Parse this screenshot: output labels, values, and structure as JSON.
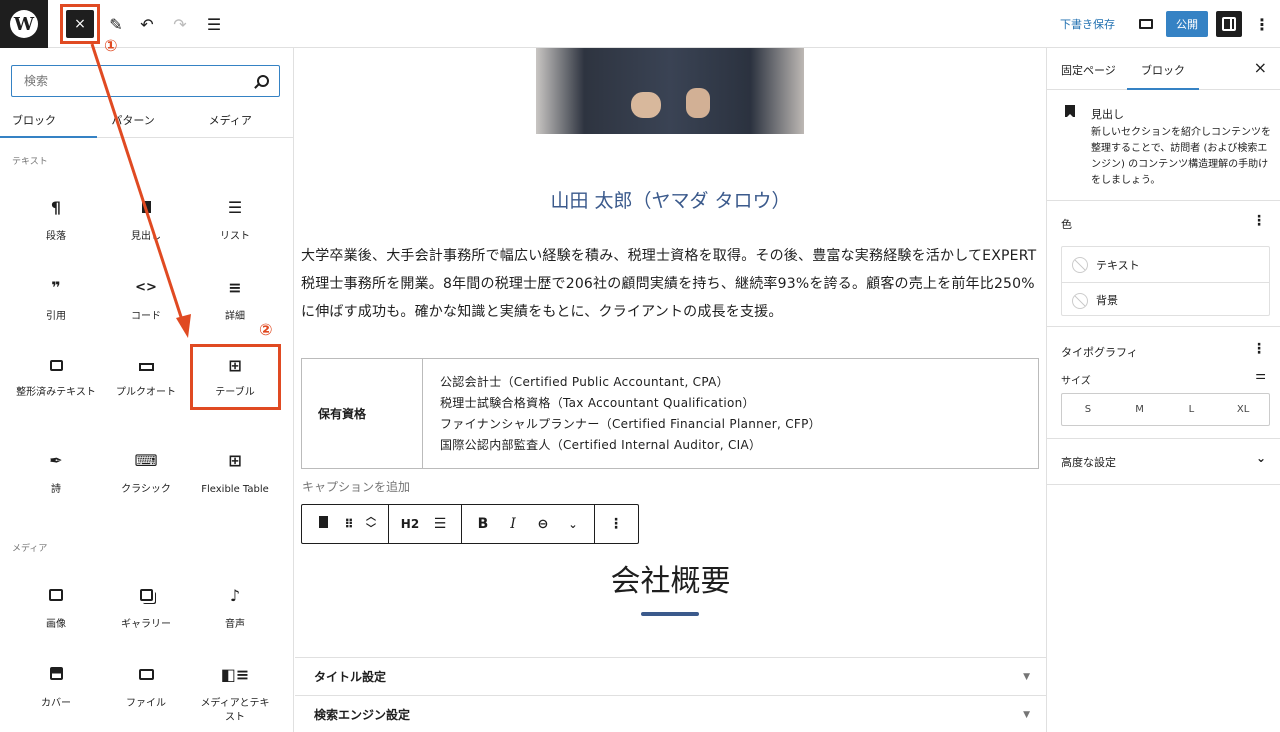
{
  "topbar": {
    "close_icon": "×",
    "draft_label": "下書き保存",
    "publish_label": "公開"
  },
  "inserter": {
    "search_placeholder": "検索",
    "tabs": [
      "ブロック",
      "パターン",
      "メディア"
    ],
    "active_tab": "ブロック",
    "text_category": "テキスト",
    "text_blocks": [
      {
        "label": "段落",
        "icon": "¶"
      },
      {
        "label": "見出し",
        "icon": "bookmark"
      },
      {
        "label": "リスト",
        "icon": "list"
      },
      {
        "label": "引用",
        "icon": "99"
      },
      {
        "label": "コード",
        "icon": "<>"
      },
      {
        "label": "詳細",
        "icon": "details"
      },
      {
        "label": "整形済みテキスト",
        "icon": "preformatted"
      },
      {
        "label": "プルクオート",
        "icon": "pullquote"
      },
      {
        "label": "テーブル",
        "icon": "table"
      },
      {
        "label": "詩",
        "icon": "feather"
      },
      {
        "label": "クラシック",
        "icon": "keyboard"
      },
      {
        "label": "Flexible Table",
        "icon": "flexible-table"
      }
    ],
    "media_category": "メディア",
    "media_blocks": [
      {
        "label": "画像",
        "icon": "image"
      },
      {
        "label": "ギャラリー",
        "icon": "gallery"
      },
      {
        "label": "音声",
        "icon": "♪"
      },
      {
        "label": "カバー",
        "icon": "cover"
      },
      {
        "label": "ファイル",
        "icon": "folder"
      },
      {
        "label": "メディアとテキスト",
        "icon": "media-text"
      }
    ]
  },
  "canvas": {
    "name_heading": "山田 太郎（ヤマダ タロウ）",
    "bio": "大学卒業後、大手会計事務所で幅広い経験を積み、税理士資格を取得。その後、豊富な実務経験を活かしてEXPERT税理士事務所を開業。8年間の税理士歴で206社の顧問実績を持ち、継続率93%を誇る。顧客の売上を前年比250%に伸ばす成功も。確かな知識と実績をもとに、クライアントの成長を支援。",
    "table": {
      "header": "保有資格",
      "lines": [
        "公認会計士（Certified Public Accountant, CPA）",
        "税理士試験合格資格（Tax Accountant Qualification）",
        "ファイナンシャルプランナー（Certified Financial Planner, CFP）",
        "国際公認内部監査人（Certified Internal Auditor, CIA）"
      ]
    },
    "caption_placeholder": "キャプションを追加",
    "toolbar": {
      "heading_level": "H2",
      "bold": "B",
      "italic": "I"
    },
    "section_heading": "会社概要",
    "meta_panels": [
      "タイトル設定",
      "検索エンジン設定"
    ]
  },
  "sidebar": {
    "tabs": [
      "固定ページ",
      "ブロック"
    ],
    "active_tab": "ブロック",
    "block_title": "見出し",
    "block_desc": "新しいセクションを紹介しコンテンツを整理することで、訪問者 (および検索エンジン) のコンテンツ構造理解の手助けをしましょう。",
    "color_title": "色",
    "color_items": [
      "テキスト",
      "背景"
    ],
    "typography_title": "タイポグラフィ",
    "size_label": "サイズ",
    "sizes": [
      "S",
      "M",
      "L",
      "XL"
    ],
    "advanced_title": "高度な設定"
  },
  "annotations": {
    "step1": "①",
    "step2": "②"
  },
  "colors": {
    "accent": "#3582c4",
    "annotation": "#e04a22",
    "heading_blue": "#3b5a8c"
  }
}
